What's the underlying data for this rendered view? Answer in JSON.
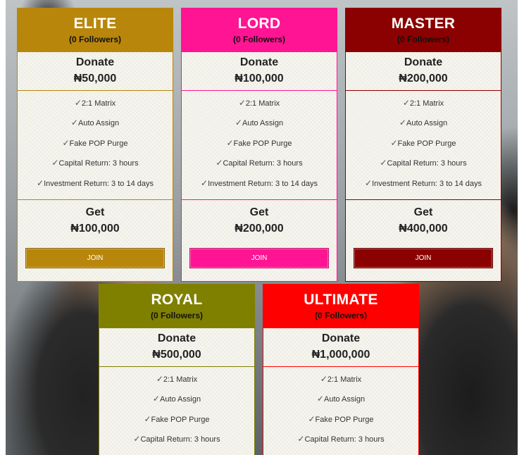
{
  "plans": [
    {
      "name": "ELITE",
      "followers": "(0 Followers)",
      "color": "#b8860b",
      "donate_label": "Donate",
      "donate_amount": "₦50,000",
      "features": [
        "2:1 Matrix",
        "Auto Assign",
        "Fake POP Purge",
        "Capital Return: 3 hours",
        "Investment Return: 3 to 14 days"
      ],
      "get_label": "Get",
      "get_amount": "₦100,000",
      "join_label": "JOIN"
    },
    {
      "name": "LORD",
      "followers": "(0 Followers)",
      "color": "#ff1493",
      "donate_label": "Donate",
      "donate_amount": "₦100,000",
      "features": [
        "2:1 Matrix",
        "Auto Assign",
        "Fake POP Purge",
        "Capital Return: 3 hours",
        "Investment Return: 3 to 14 days"
      ],
      "get_label": "Get",
      "get_amount": "₦200,000",
      "join_label": "JOIN"
    },
    {
      "name": "MASTER",
      "followers": "(0 Followers)",
      "color": "#8b0000",
      "donate_label": "Donate",
      "donate_amount": "₦200,000",
      "features": [
        "2:1 Matrix",
        "Auto Assign",
        "Fake POP Purge",
        "Capital Return: 3 hours",
        "Investment Return: 3 to 14 days"
      ],
      "get_label": "Get",
      "get_amount": "₦400,000",
      "join_label": "JOIN"
    },
    {
      "name": "ROYAL",
      "followers": "(0 Followers)",
      "color": "#808000",
      "donate_label": "Donate",
      "donate_amount": "₦500,000",
      "features": [
        "2:1 Matrix",
        "Auto Assign",
        "Fake POP Purge",
        "Capital Return: 3 hours"
      ]
    },
    {
      "name": "ULTIMATE",
      "followers": "(0 Followers)",
      "color": "#ff0000",
      "donate_label": "Donate",
      "donate_amount": "₦1,000,000",
      "features": [
        "2:1 Matrix",
        "Auto Assign",
        "Fake POP Purge",
        "Capital Return: 3 hours"
      ]
    }
  ],
  "check_glyph": "✓"
}
